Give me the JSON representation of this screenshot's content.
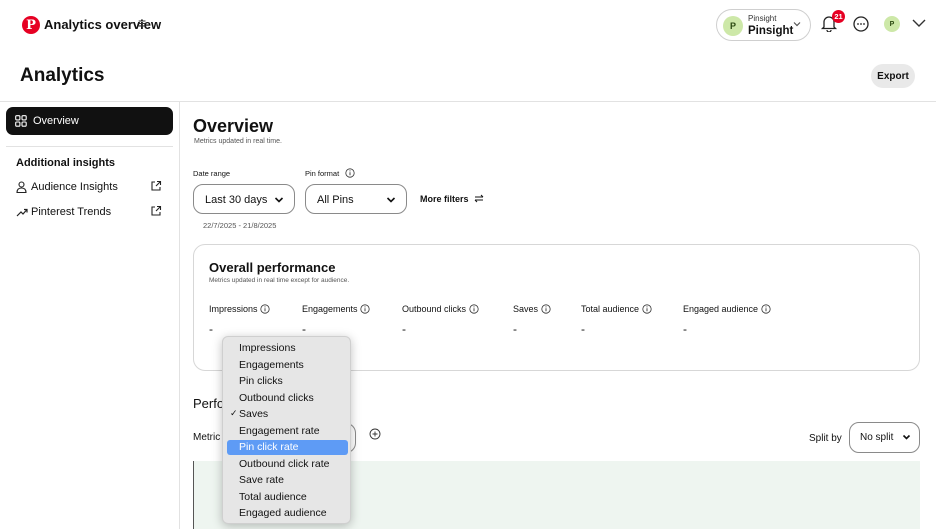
{
  "header": {
    "logo_letter": "P",
    "app_title": "Analytics overview",
    "menu_glyph": "≡",
    "account": {
      "avatar_letter": "P",
      "small_name": "Pinsight",
      "name": "Pinsight"
    },
    "notification_count": "21",
    "avatar_letter": "P"
  },
  "page": {
    "title": "Analytics",
    "export_label": "Export"
  },
  "sidebar": {
    "overview_label": "Overview",
    "section_heading": "Additional insights",
    "links": [
      {
        "label": "Audience Insights",
        "icon": "person-icon"
      },
      {
        "label": "Pinterest Trends",
        "icon": "trend-icon"
      }
    ]
  },
  "main": {
    "title": "Overview",
    "subtitle": "Metrics updated in real time.",
    "filters": {
      "date_range_label": "Date range",
      "date_range_value": "Last 30 days",
      "pin_format_label": "Pin format",
      "pin_format_value": "All Pins",
      "more_filters": "More filters",
      "date_caption": "22/7/2025 - 21/8/2025"
    },
    "overall": {
      "title": "Overall performance",
      "subtitle": "Metrics updated in real time except for audience.",
      "metrics": [
        {
          "label": "Impressions",
          "value": "-"
        },
        {
          "label": "Engagements",
          "value": "-"
        },
        {
          "label": "Outbound clicks",
          "value": "-"
        },
        {
          "label": "Saves",
          "value": "-"
        },
        {
          "label": "Total audience",
          "value": "-"
        },
        {
          "label": "Engaged audience",
          "value": "-"
        }
      ]
    },
    "performance": {
      "title_visible": "Perfo",
      "metric_label_visible": "Metric",
      "split_label": "Split by",
      "split_value": "No split"
    },
    "dropdown": {
      "items": [
        "Impressions",
        "Engagements",
        "Pin clicks",
        "Outbound clicks",
        "Saves",
        "Engagement rate",
        "Pin click rate",
        "Outbound click rate",
        "Save rate",
        "Total audience",
        "Engaged audience"
      ],
      "checked": "Saves",
      "highlighted": "Pin click rate",
      "check_glyph": "✓"
    }
  },
  "colors": {
    "brand_red": "#e60023",
    "highlight_blue": "#5e9bf5",
    "chart_bg": "#eef5f0",
    "avatar_green": "#cde8a8"
  }
}
